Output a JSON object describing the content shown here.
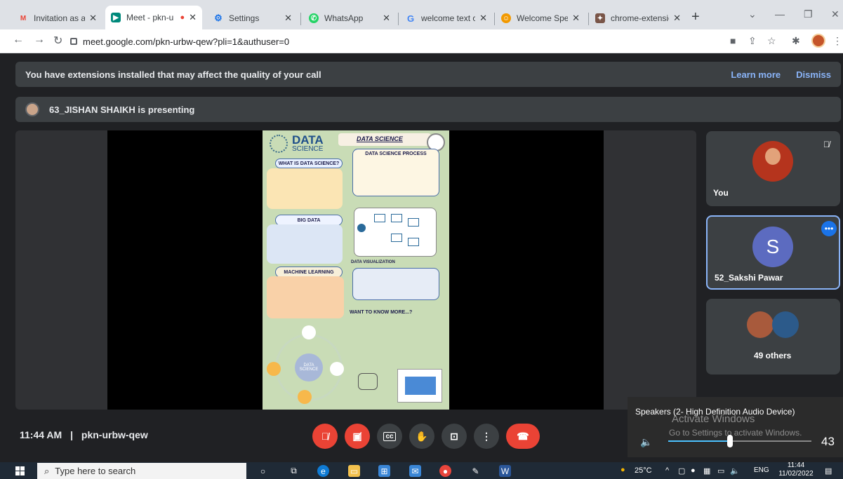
{
  "browser": {
    "tabs": [
      {
        "title": "Invitation as a Ju",
        "favicon": "gmail-icon",
        "color": "#ea4335"
      },
      {
        "title": "Meet - pkn-u",
        "favicon": "meet-icon",
        "color": "#00897b",
        "active": true
      },
      {
        "title": "Settings",
        "favicon": "gear-icon",
        "color": "#1a73e8"
      },
      {
        "title": "WhatsApp",
        "favicon": "whatsapp-icon",
        "color": "#25d366"
      },
      {
        "title": "welcome text co",
        "favicon": "google-icon",
        "color": "#4285f4"
      },
      {
        "title": "Welcome Speech",
        "favicon": "speech-icon",
        "color": "#f29900"
      },
      {
        "title": "chrome-extensio",
        "favicon": "extension-icon",
        "color": "#795548"
      }
    ],
    "url": "meet.google.com/pkn-urbw-qew?pli=1&authuser=0"
  },
  "meet": {
    "banner": {
      "message": "You have extensions installed that may affect the quality of your call",
      "learn_more": "Learn more",
      "dismiss": "Dismiss"
    },
    "presenter_text": "63_JISHAN SHAIKH is presenting",
    "participants": {
      "you": "You",
      "sakshi": {
        "initial": "S",
        "name": "52_Sakshi Pawar"
      },
      "others": "49 others"
    },
    "time": "11:44 AM",
    "separator": "|",
    "meeting_code": "pkn-urbw-qew"
  },
  "poster": {
    "header": "DATA",
    "header_sub": "SCIENCE",
    "title": "DATA SCIENCE",
    "process": "DATA SCIENCE PROCESS",
    "what": "WHAT IS DATA SCIENCE?",
    "big": "BIG DATA",
    "ml": "MACHINE LEARNING",
    "vis": "DATA VISUALIZATION",
    "want": "WANT TO KNOW MORE...?",
    "center": "DATA SCIENCE"
  },
  "volume": {
    "device": "Speakers (2- High Definition Audio Device)",
    "level": 43,
    "watermark_title": "Activate Windows",
    "watermark_sub": "Go to Settings to activate Windows."
  },
  "taskbar": {
    "search_placeholder": "Type here to search",
    "weather": "25°C",
    "lang": "ENG",
    "clock_time": "11:44",
    "clock_date": "11/02/2022"
  },
  "colors": {
    "meet_bg": "#202124",
    "tile_bg": "#3c4043",
    "end_call": "#ea4335",
    "link": "#8ab4f8",
    "selected_border": "#8ab4f8"
  }
}
